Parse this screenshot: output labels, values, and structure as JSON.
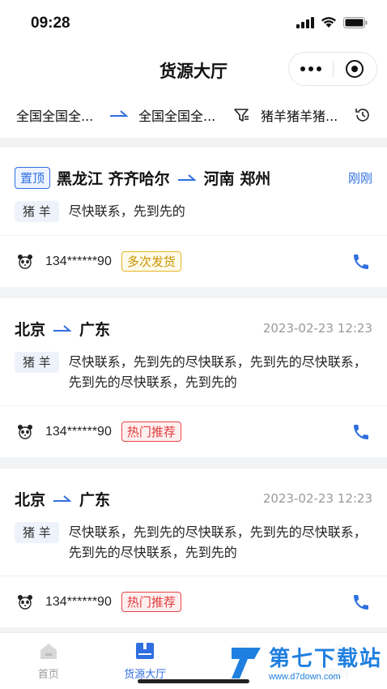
{
  "status": {
    "time": "09:28"
  },
  "nav": {
    "title": "货源大厅"
  },
  "filter": {
    "origin": "全国全国全...",
    "destination": "全国全国全...",
    "cargo": "猪羊猪羊猪..."
  },
  "cards": [
    {
      "pinned_label": "置顶",
      "from": "黑龙江 齐齐哈尔",
      "to": "河南 郑州",
      "time": "刚刚",
      "cargo": "猪 羊",
      "desc": "尽快联系，先到先的",
      "phone": "134******90",
      "badge": "多次发货"
    },
    {
      "from": "北京",
      "to": "广东",
      "time": "2023-02-23 12:23",
      "cargo": "猪 羊",
      "desc": "尽快联系，先到先的尽快联系，先到先的尽快联系，先到先的尽快联系，先到先的",
      "phone": "134******90",
      "badge": "热门推荐"
    },
    {
      "from": "北京",
      "to": "广东",
      "time": "2023-02-23 12:23",
      "cargo": "猪 羊",
      "desc": "尽快联系，先到先的尽快联系，先到先的尽快联系，先到先的尽快联系，先到先的",
      "phone": "134******90",
      "badge": "热门推荐"
    }
  ],
  "tabbar": {
    "home": "首页",
    "hall": "货源大厅",
    "orders": "订",
    "mine": "我的"
  },
  "watermark": {
    "title": "第七下载站",
    "url": "www.d7down.com"
  },
  "colors": {
    "accent": "#2f6fe0",
    "hot": "#e03b3b",
    "repeat": "#c89400"
  }
}
